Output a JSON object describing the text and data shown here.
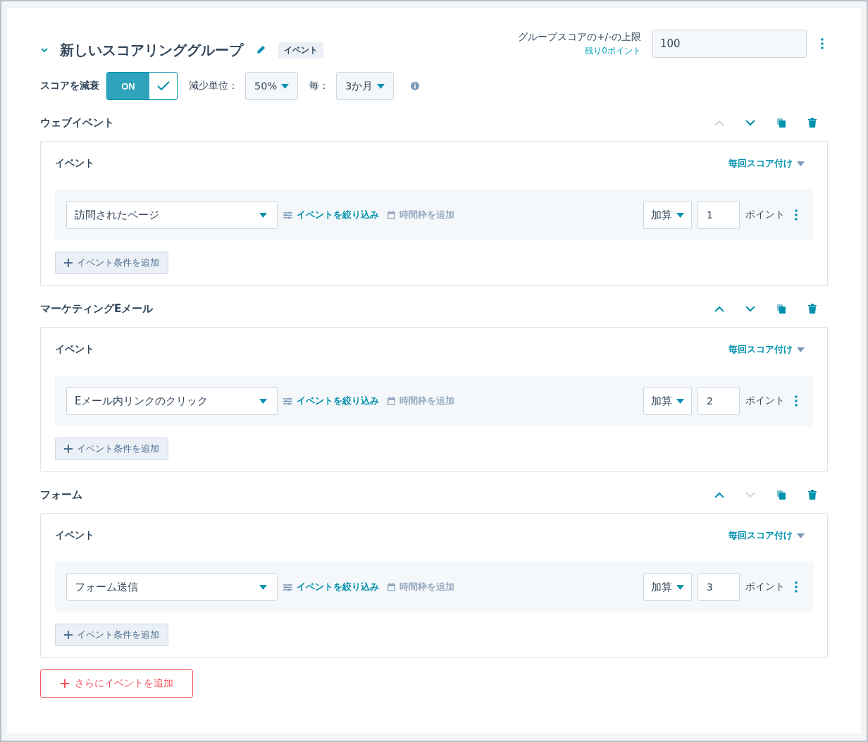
{
  "header": {
    "expanded": true,
    "title": "新しいスコアリンググループ",
    "tag": "イベント",
    "limit_label": "グループスコアの+/-の上限",
    "limit_remaining": "残り0ポイント",
    "limit_value": "100"
  },
  "decay": {
    "label": "スコアを減衰",
    "toggle_label": "ON",
    "on": true,
    "unit_label": "減少単位：",
    "unit_value": "50%",
    "every_label": "毎：",
    "every_value": "3か月"
  },
  "sections": [
    {
      "title": "ウェブイベント",
      "up_disabled": true,
      "down_disabled": false,
      "column_label": "イベント",
      "frequency": "毎回スコア付け",
      "event": "訪問されたページ",
      "filter_link": "イベントを絞り込み",
      "timeframe_link": "時間枠を追加",
      "operation": "加算",
      "points": "1",
      "points_label": "ポイント",
      "add_condition": "イベント条件を追加"
    },
    {
      "title": "マーケティングEメール",
      "up_disabled": false,
      "down_disabled": false,
      "column_label": "イベント",
      "frequency": "毎回スコア付け",
      "event": "Eメール内リンクのクリック",
      "filter_link": "イベントを絞り込み",
      "timeframe_link": "時間枠を追加",
      "operation": "加算",
      "points": "2",
      "points_label": "ポイント",
      "add_condition": "イベント条件を追加"
    },
    {
      "title": "フォーム",
      "up_disabled": false,
      "down_disabled": true,
      "column_label": "イベント",
      "frequency": "毎回スコア付け",
      "event": "フォーム送信",
      "filter_link": "イベントを絞り込み",
      "timeframe_link": "時間枠を追加",
      "operation": "加算",
      "points": "3",
      "points_label": "ポイント",
      "add_condition": "イベント条件を追加"
    }
  ],
  "add_event_button": "さらにイベントを追加"
}
